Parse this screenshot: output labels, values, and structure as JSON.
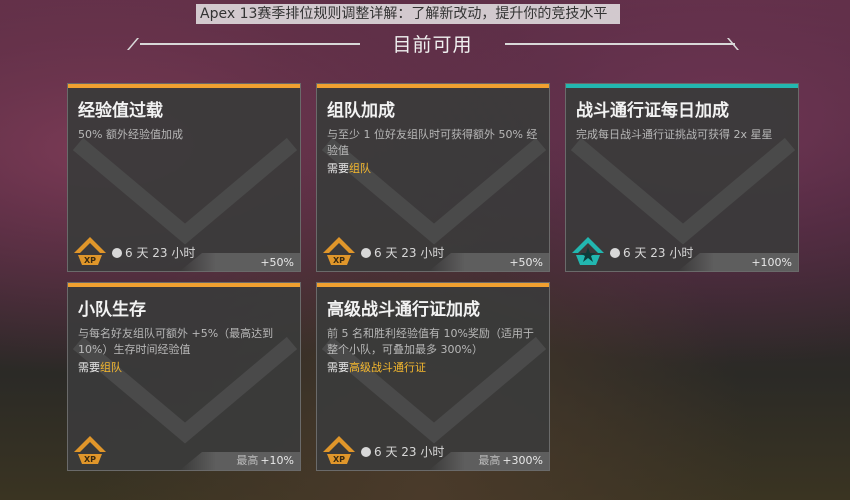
{
  "caption": "Apex 13赛季排位规则调整详解：了解新改动，提升你的竞技水平",
  "header": {
    "title": "目前可用"
  },
  "cards": [
    {
      "title": "经验值过载",
      "desc": "50% 额外经验值加成",
      "req_prefix": "",
      "req_value": "",
      "timer": "6 天 23 小时",
      "bonus_prefix": "",
      "bonus": "+50%",
      "badge": "XP",
      "accent": "#f0a030"
    },
    {
      "title": "组队加成",
      "desc": "与至少 1 位好友组队时可获得额外 50% 经验值",
      "req_prefix": "需要",
      "req_value": "组队",
      "timer": "6 天 23 小时",
      "bonus_prefix": "",
      "bonus": "+50%",
      "badge": "XP",
      "accent": "#f0a030"
    },
    {
      "title": "战斗通行证每日加成",
      "desc": "完成每日战斗通行证挑战可获得 2x 星星",
      "req_prefix": "",
      "req_value": "",
      "timer": "6 天 23 小时",
      "bonus_prefix": "",
      "bonus": "+100%",
      "badge": "star",
      "accent": "#22b7b0"
    },
    {
      "title": "小队生存",
      "desc": "与每名好友组队可额外 +5%（最高达到 10%）生存时间经验值",
      "req_prefix": "需要",
      "req_value": "组队",
      "timer": "",
      "bonus_prefix": "最高",
      "bonus": "+10%",
      "badge": "XP",
      "accent": "#f0a030"
    },
    {
      "title": "高级战斗通行证加成",
      "desc": "前 5 名和胜利经验值有 10%奖励（适用于整个小队，可叠加最多 300%）",
      "req_prefix": "需要",
      "req_value": "高级战斗通行证",
      "timer": "6 天 23 小时",
      "bonus_prefix": "最高",
      "bonus": "+300%",
      "badge": "XP",
      "accent": "#f0a030"
    }
  ]
}
